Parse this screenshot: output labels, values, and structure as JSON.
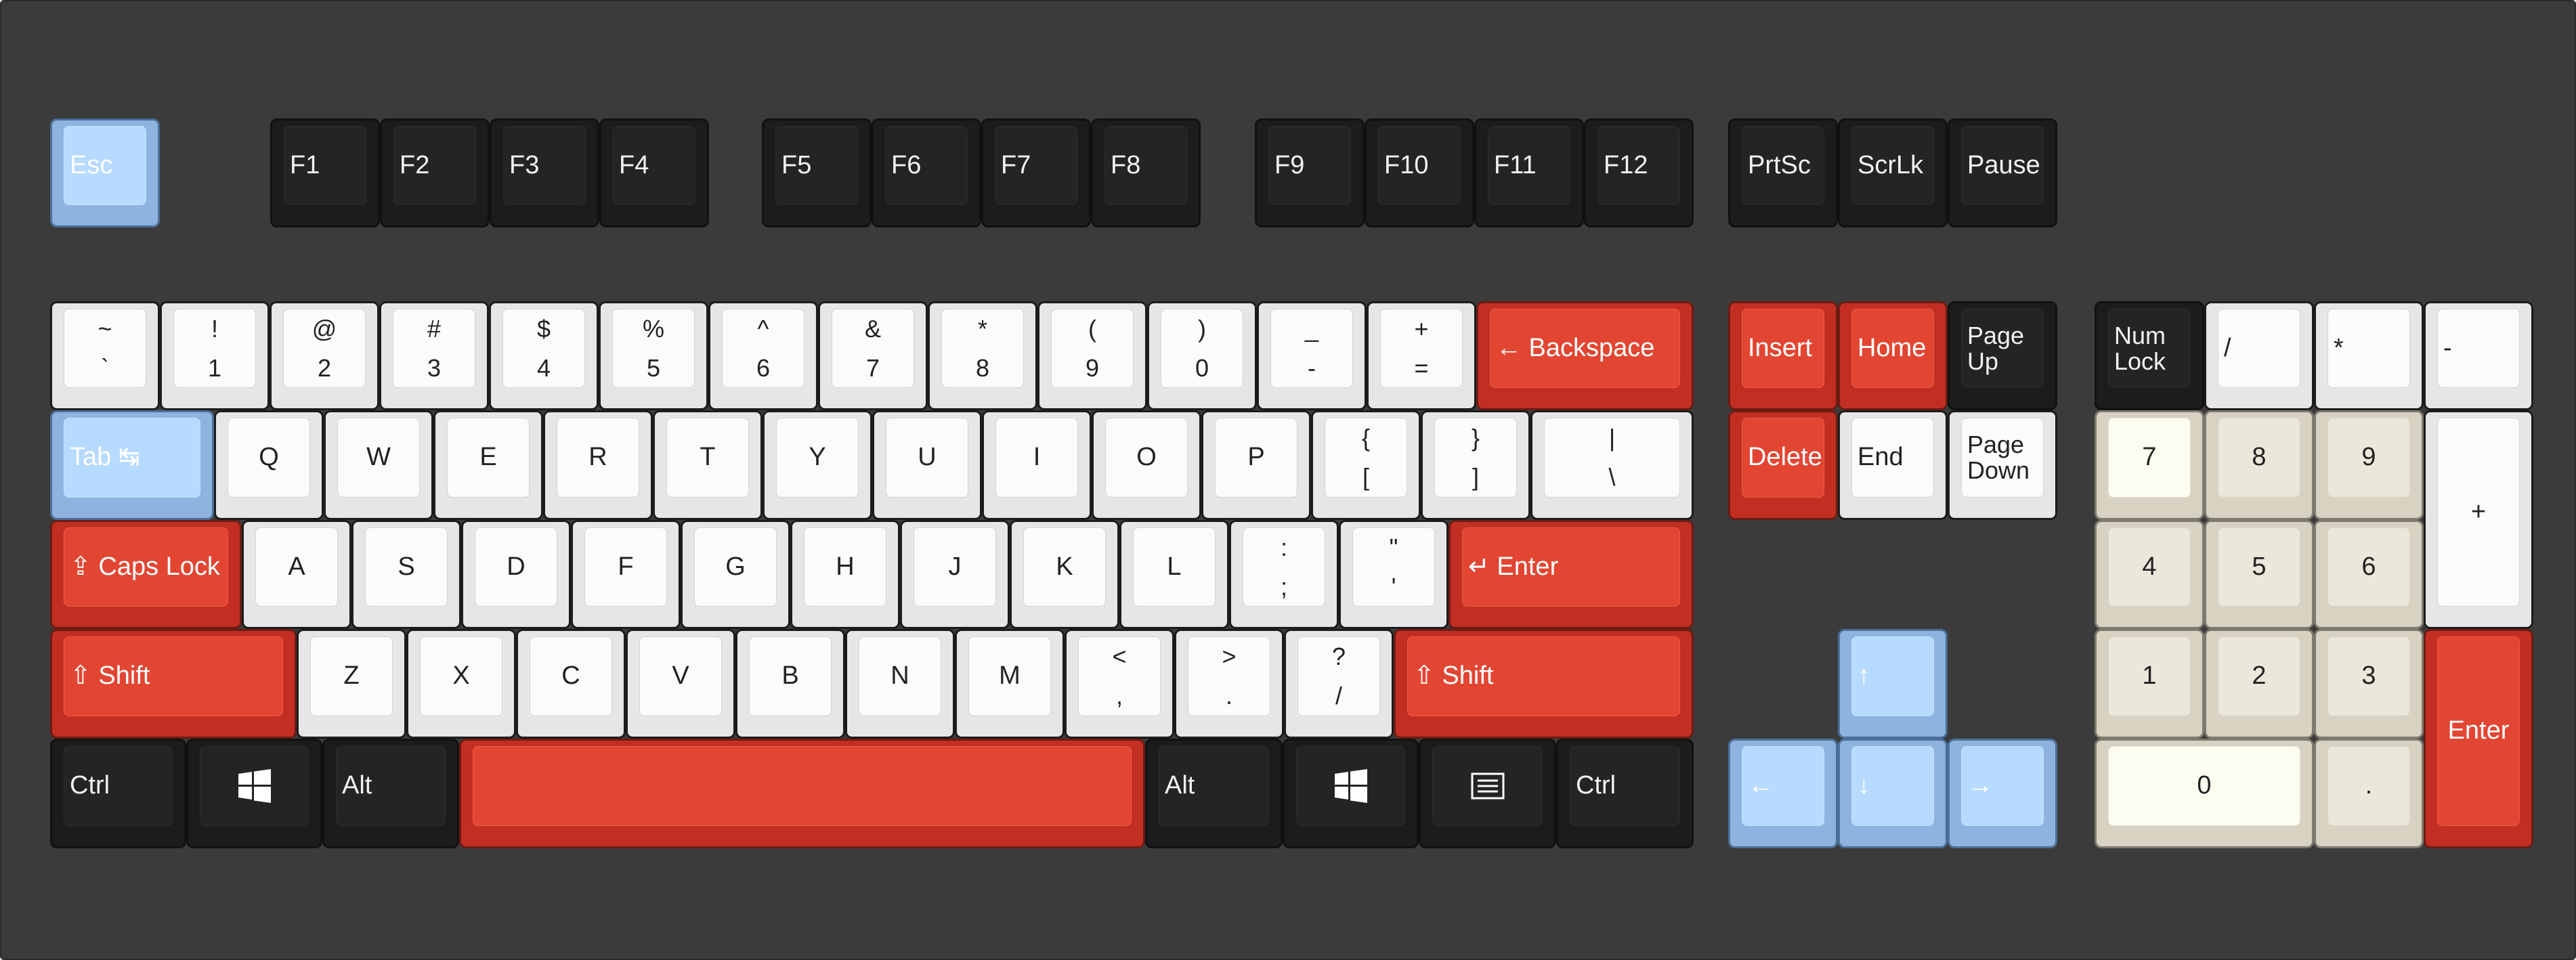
{
  "keyboard": {
    "function_row": {
      "esc": "Esc",
      "f1": "F1",
      "f2": "F2",
      "f3": "F3",
      "f4": "F4",
      "f5": "F5",
      "f6": "F6",
      "f7": "F7",
      "f8": "F8",
      "f9": "F9",
      "f10": "F10",
      "f11": "F11",
      "f12": "F12",
      "prtsc": "PrtSc",
      "scrlk": "ScrLk",
      "pause": "Pause"
    },
    "number_row": {
      "backtick": {
        "top": "~",
        "bottom": "`"
      },
      "1": {
        "top": "!",
        "bottom": "1"
      },
      "2": {
        "top": "@",
        "bottom": "2"
      },
      "3": {
        "top": "#",
        "bottom": "3"
      },
      "4": {
        "top": "$",
        "bottom": "4"
      },
      "5": {
        "top": "%",
        "bottom": "5"
      },
      "6": {
        "top": "^",
        "bottom": "6"
      },
      "7": {
        "top": "&",
        "bottom": "7"
      },
      "8": {
        "top": "*",
        "bottom": "8"
      },
      "9": {
        "top": "(",
        "bottom": "9"
      },
      "0": {
        "top": ")",
        "bottom": "0"
      },
      "minus": {
        "top": "_",
        "bottom": "-"
      },
      "equals": {
        "top": "+",
        "bottom": "="
      },
      "backspace": "← Backspace"
    },
    "top_row": {
      "tab": "Tab ↹",
      "q": "Q",
      "w": "W",
      "e": "E",
      "r": "R",
      "t": "T",
      "y": "Y",
      "u": "U",
      "i": "I",
      "o": "O",
      "p": "P",
      "lbracket": {
        "top": "{",
        "bottom": "["
      },
      "rbracket": {
        "top": "}",
        "bottom": "]"
      },
      "backslash": {
        "top": "|",
        "bottom": "\\"
      }
    },
    "home_row": {
      "capslock": "⇪ Caps Lock",
      "a": "A",
      "s": "S",
      "d": "D",
      "f": "F",
      "g": "G",
      "h": "H",
      "j": "J",
      "k": "K",
      "l": "L",
      "semicolon": {
        "top": ":",
        "bottom": ";"
      },
      "quote": {
        "top": "\"",
        "bottom": "'"
      },
      "enter": "↵ Enter"
    },
    "bottom_row": {
      "lshift": "⇧ Shift",
      "z": "Z",
      "x": "X",
      "c": "C",
      "v": "V",
      "b": "B",
      "n": "N",
      "m": "M",
      "comma": {
        "top": "<",
        "bottom": ","
      },
      "period": {
        "top": ">",
        "bottom": "."
      },
      "slash": {
        "top": "?",
        "bottom": "/"
      },
      "rshift": "⇧ Shift"
    },
    "modifier_row": {
      "lctrl": "Ctrl",
      "lwin": "windows-logo-icon",
      "lalt": "Alt",
      "space": "",
      "ralt": "Alt",
      "rwin": "windows-logo-icon",
      "menu": "menu-icon",
      "rctrl": "Ctrl"
    },
    "nav_cluster": {
      "insert": "Insert",
      "home": "Home",
      "pageup": "Page Up",
      "delete": "Delete",
      "end": "End",
      "pagedown": "Page Down"
    },
    "arrows": {
      "up": "↑",
      "left": "←",
      "down": "↓",
      "right": "→"
    },
    "numpad": {
      "numlock": "Num Lock",
      "divide": "/",
      "multiply": "*",
      "subtract": "-",
      "7": "7",
      "8": "8",
      "9": "9",
      "add": "+",
      "4": "4",
      "5": "5",
      "6": "6",
      "1": "1",
      "2": "2",
      "3": "3",
      "enter": "Enter",
      "0": "0",
      "decimal": "."
    }
  },
  "colors": {
    "case": "#3b3b3b",
    "alpha_white": "#fbfbfb",
    "modifier_black": "#242424",
    "accent_red": "#e24632",
    "accent_blue": "#b7daff",
    "numpad_cream": "#fdfcf0",
    "numpad_beige": "#ebe7da"
  }
}
